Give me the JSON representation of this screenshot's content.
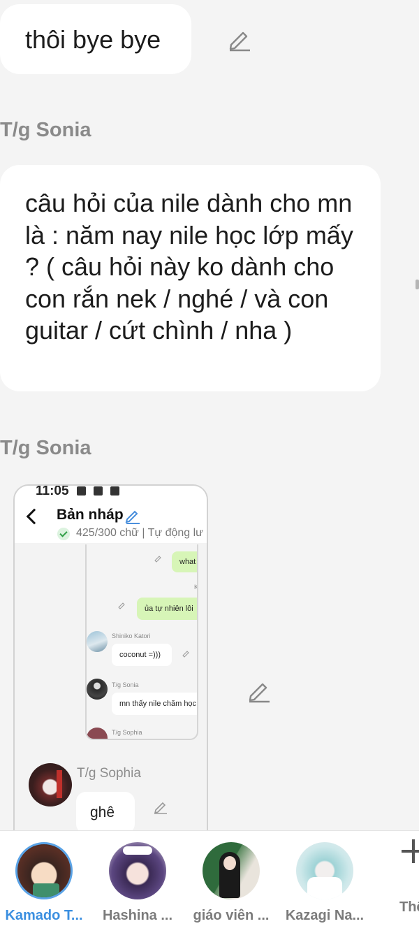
{
  "messages": [
    {
      "text": "thôi bye bye"
    },
    {
      "sender": "T/g Sonia",
      "text": "câu hỏi của nile dành cho mn là : năm nay nile học lớp mấy ? ( câu hỏi này ko dành cho con rắn nek / nghé / và con guitar / cứt chình / nha )"
    },
    {
      "sender": "T/g Sonia"
    }
  ],
  "embedded_screenshot": {
    "time": "11:05",
    "title": "Bản nháp",
    "status": "425/300 chữ | Tự động lư",
    "inner_messages": [
      {
        "text": "what"
      },
      {
        "text": "K"
      },
      {
        "text": "ủa tự nhiên lôi"
      },
      {
        "sender": "Shiniko Katori",
        "text": "coconut =)))"
      },
      {
        "sender": "T/g Sonia",
        "text": "mn thấy nile chăm học"
      },
      {
        "sender": "T/g Sophia"
      }
    ],
    "last_sender": "T/g Sophia",
    "last_text": "ghê"
  },
  "characters": [
    {
      "name": "Kamado T...",
      "selected": true
    },
    {
      "name": "Hashina ..."
    },
    {
      "name": "giáo viên ..."
    },
    {
      "name": "Kazagi Na..."
    }
  ],
  "more_label": "Thê",
  "colors": {
    "accent": "#3b8fe0",
    "green_bubble": "#d7f5b7"
  }
}
